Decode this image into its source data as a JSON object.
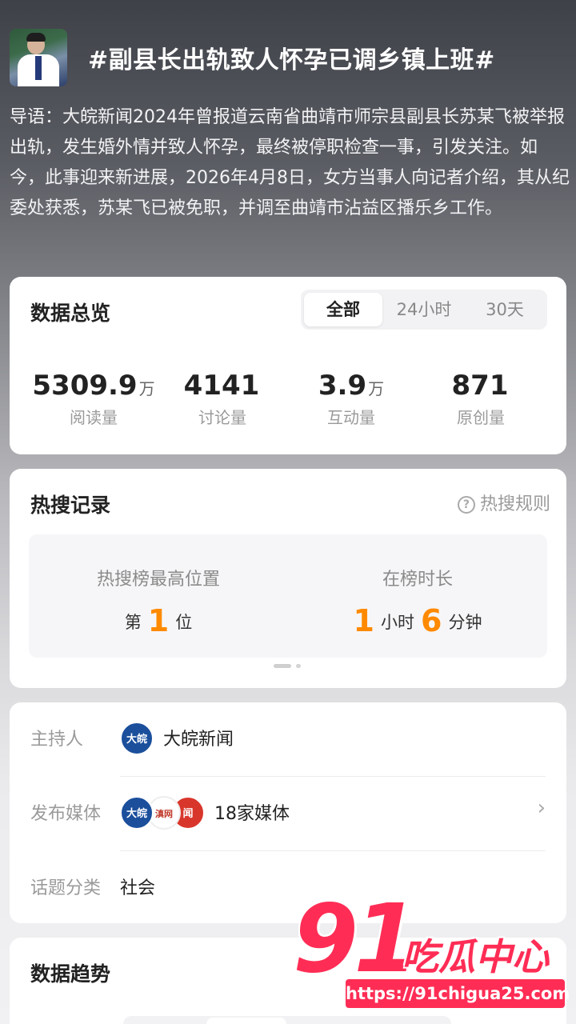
{
  "topic": {
    "title": "#副县长出轨致人怀孕已调乡镇上班#",
    "intro": "导语：大皖新闻2024年曾报道云南省曲靖市师宗县副县长苏某飞被举报出轨，发生婚外情并致人怀孕，最终被停职检查一事，引发关注。如今，此事迎来新进展，2026年4月8日，女方当事人向记者介绍，其从纪委处获悉，苏某飞已被免职，并调至曲靖市沾益区播乐乡工作。"
  },
  "overview": {
    "title": "数据总览",
    "tabs": [
      "全部",
      "24小时",
      "30天"
    ],
    "active_tab": "全部",
    "stats": [
      {
        "value": "5309.9",
        "unit": "万",
        "label": "阅读量"
      },
      {
        "value": "4141",
        "unit": "",
        "label": "讨论量"
      },
      {
        "value": "3.9",
        "unit": "万",
        "label": "互动量"
      },
      {
        "value": "871",
        "unit": "",
        "label": "原创量"
      }
    ]
  },
  "hot_search": {
    "title": "热搜记录",
    "rules_label": "热搜规则",
    "peak_label": "热搜榜最高位置",
    "peak_prefix": "第",
    "peak_value": "1",
    "peak_suffix": "位",
    "duration_label": "在榜时长",
    "duration_hours": "1",
    "duration_hours_unit": "小时",
    "duration_minutes": "6",
    "duration_minutes_unit": "分钟"
  },
  "info": {
    "host_label": "主持人",
    "host_name": "大皖新闻",
    "media_label": "发布媒体",
    "media_value": "18家媒体",
    "category_label": "话题分类",
    "category_value": "社会",
    "logo_text_1": "大皖",
    "logo_text_2": "滇网",
    "logo_text_3": "闻"
  },
  "trend": {
    "title": "数据趋势"
  },
  "watermark": {
    "number": "91",
    "name": "吃瓜中心",
    "url": "https://91chigua25.com"
  },
  "colors": {
    "accent_orange": "#ff8a00",
    "watermark_red": "#ff2d55",
    "card_bg": "#ffffff"
  }
}
